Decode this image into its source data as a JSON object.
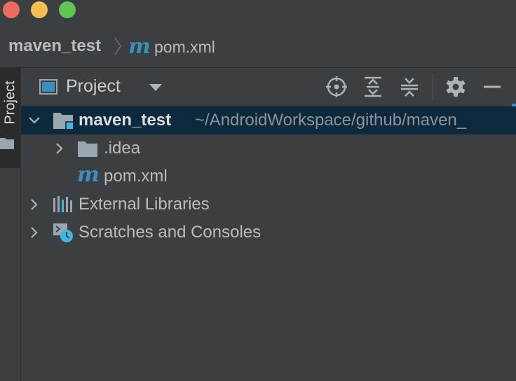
{
  "breadcrumb": {
    "project": "maven_test",
    "file_icon_letter": "m",
    "file": "pom.xml"
  },
  "side_stripe": {
    "project_tab_label": "Project"
  },
  "project_panel": {
    "view_selector_label": "Project",
    "toolbar_icons": [
      "locate-icon",
      "expand-all-icon",
      "collapse-all-icon",
      "gear-icon",
      "minimize-icon"
    ]
  },
  "tree": {
    "root": {
      "name": "maven_test",
      "path": "~/AndroidWorkspace/github/maven_"
    },
    "children": [
      {
        "name": ".idea",
        "icon": "folder-icon"
      },
      {
        "name": "pom.xml",
        "icon_letter": "m"
      }
    ],
    "external_libraries": "External Libraries",
    "scratches": "Scratches and Consoles"
  },
  "colors": {
    "background": "#3c3f41",
    "selection": "#0d293e",
    "maven_accent": "#3d8ebf",
    "traffic_red": "#ed6a5e",
    "traffic_yellow": "#f5bf4f",
    "traffic_green": "#61c554"
  }
}
